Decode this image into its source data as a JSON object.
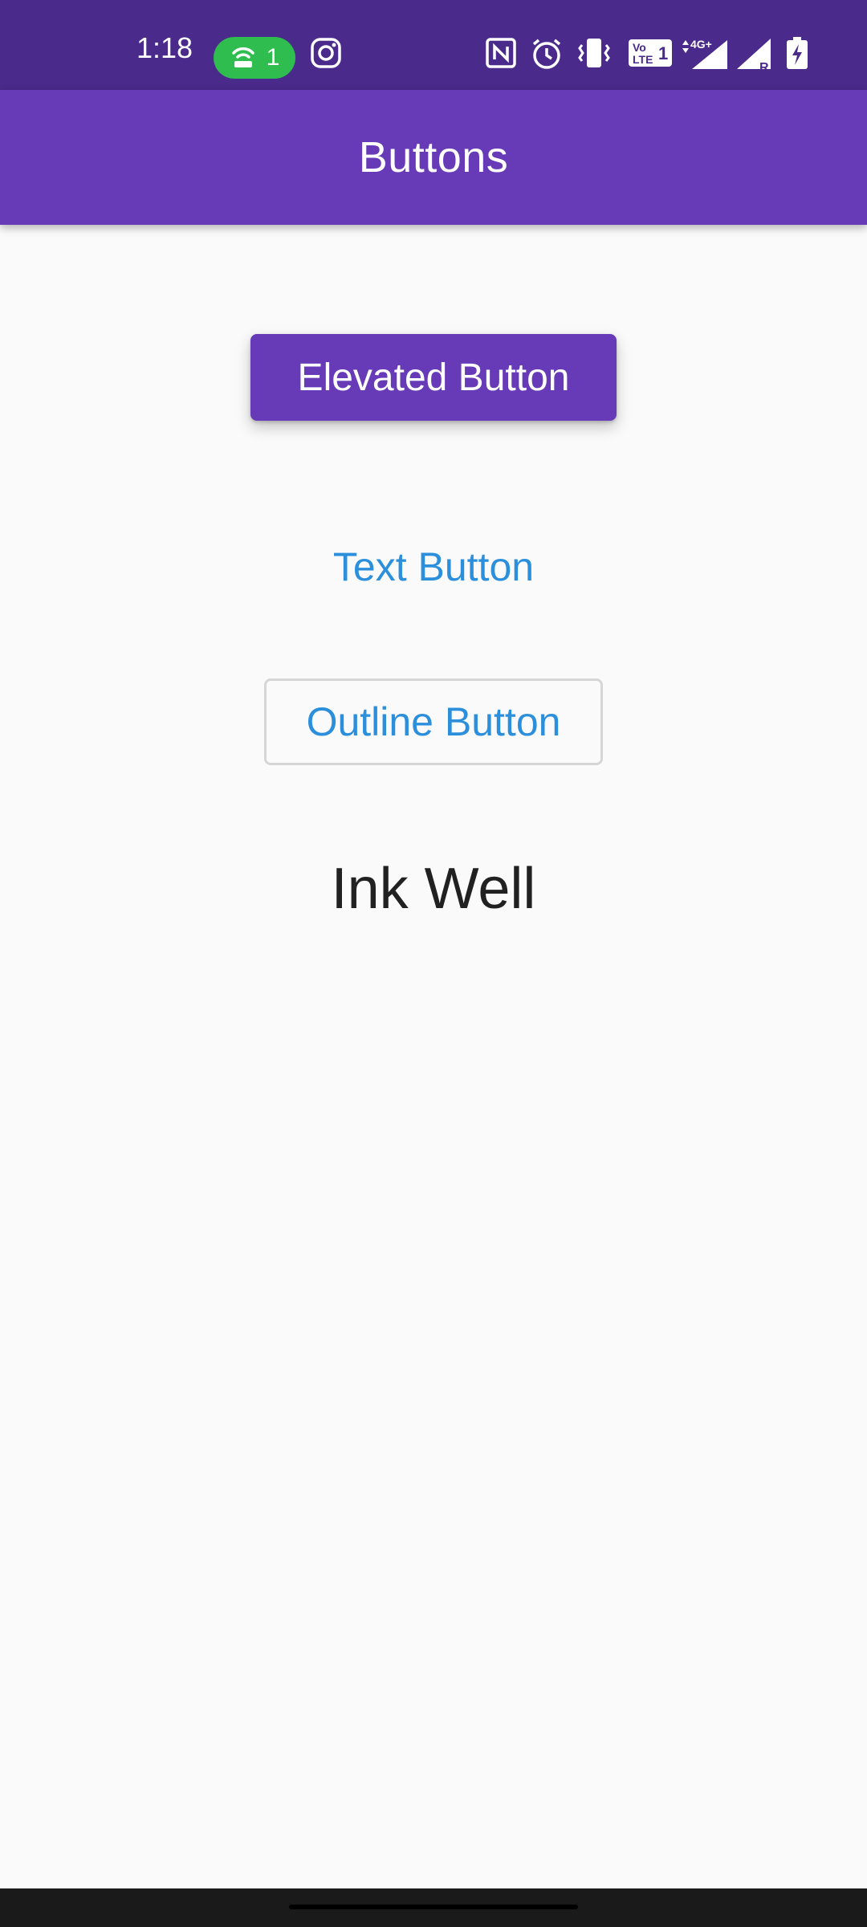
{
  "status_bar": {
    "time": "1:18",
    "hotspot_count": "1",
    "icons": [
      "hotspot-icon",
      "instagram-icon",
      "nfc-icon",
      "alarm-icon",
      "vibrate-icon",
      "volte-icon",
      "4g-data-icon",
      "signal-icon",
      "roaming-signal-icon",
      "battery-charging-icon"
    ],
    "volte_label": "Vo LTE 1",
    "network_label": "4G+",
    "roaming_label": "R"
  },
  "app_bar": {
    "title": "Buttons"
  },
  "buttons": {
    "elevated_label": "Elevated Button",
    "text_label": "Text Button",
    "outline_label": "Outline Button",
    "ink_well_label": "Ink Well"
  },
  "colors": {
    "status_bar": "#4a2a8a",
    "primary": "#673ab7",
    "text_button": "#2b8fdc",
    "background": "#fafafa",
    "hotspot_pill": "#2fbd4f"
  }
}
